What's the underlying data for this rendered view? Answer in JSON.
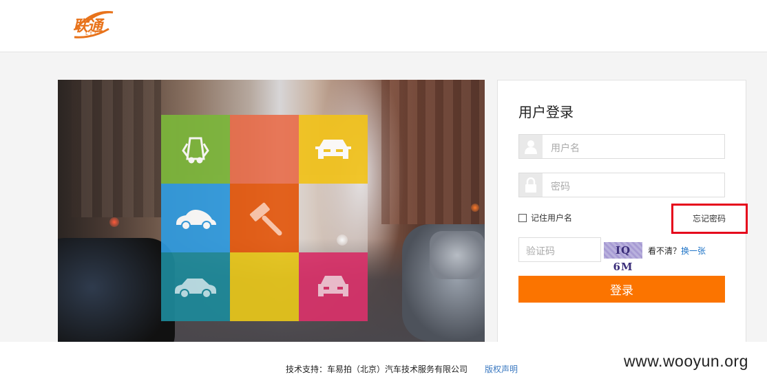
{
  "header": {
    "logo_text": "联通",
    "logo_sub": "LTG"
  },
  "colors": {
    "accent": "#fb7400",
    "forgot_highlight": "#e5001a",
    "link": "#1f74c7",
    "tiles": [
      "#7bb63a",
      "#e96a47",
      "#f2c31b",
      "#2f9be0",
      "#e4580e",
      "#eeeeee",
      "#1d8a9b",
      "#e8c71a",
      "#d9326a"
    ]
  },
  "hero": {
    "tiles": [
      {
        "icon": "car-doors-open-icon"
      },
      {
        "icon": ""
      },
      {
        "icon": "car-front-icon"
      },
      {
        "icon": "beetle-car-icon"
      },
      {
        "icon": "auction-hammer-icon"
      },
      {
        "icon": ""
      },
      {
        "icon": "sedan-icon"
      },
      {
        "icon": ""
      },
      {
        "icon": "car-rear-icon"
      }
    ]
  },
  "login": {
    "title": "用户登录",
    "username_placeholder": "用户名",
    "password_placeholder": "密码",
    "remember_label": "记住用户名",
    "forgot_label": "忘记密码",
    "captcha_placeholder": "验证码",
    "captcha_text": "IQ 6M",
    "captcha_hint": "看不清？",
    "captcha_refresh": "换一张",
    "submit_label": "登录"
  },
  "footer": {
    "support": "技术支持：车易拍（北京）汽车技术服务有限公司",
    "legal": "版权声明"
  },
  "watermark": "www.wooyun.org"
}
